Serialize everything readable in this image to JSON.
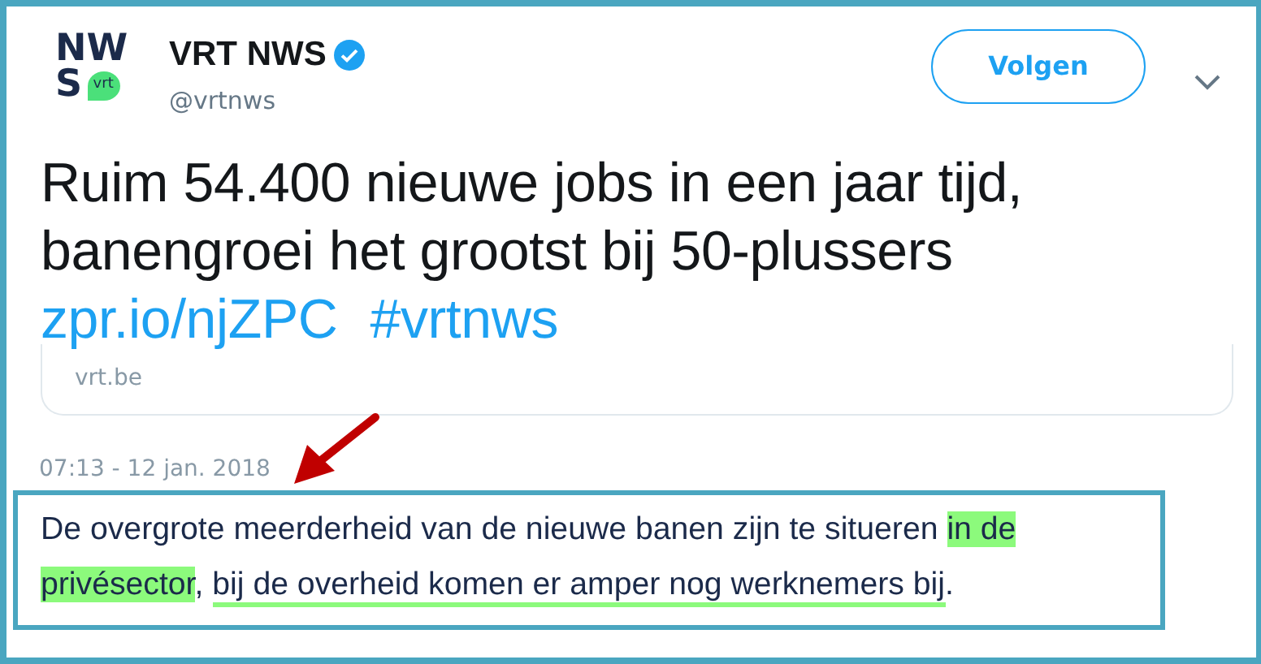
{
  "account": {
    "logo_top": "NW",
    "logo_letter": "S",
    "logo_badge": "vrt",
    "name": "VRT NWS",
    "verified": true,
    "handle": "@vrtnws"
  },
  "follow_button": {
    "label": "Volgen"
  },
  "tweet": {
    "lines": [
      "Ruim 54.400 nieuwe jobs in een jaar tijd,",
      "banengroei het grootst bij 50-plussers"
    ],
    "links": [
      "zpr.io/njZPC",
      "#vrtnws"
    ],
    "card_domain": "vrt.be",
    "timestamp": "07:13 - 12 jan. 2018"
  },
  "quote": {
    "segments": [
      {
        "text": "De overgrote meerderheid van de nieuwe banen zijn te situeren ",
        "kind": "plain"
      },
      {
        "text": "in de privésector",
        "kind": "highlight"
      },
      {
        "text": ", ",
        "kind": "plain"
      },
      {
        "text": "bij de overheid komen er amper nog werknemers bij",
        "kind": "underline"
      },
      {
        "text": ".",
        "kind": "plain"
      }
    ]
  }
}
